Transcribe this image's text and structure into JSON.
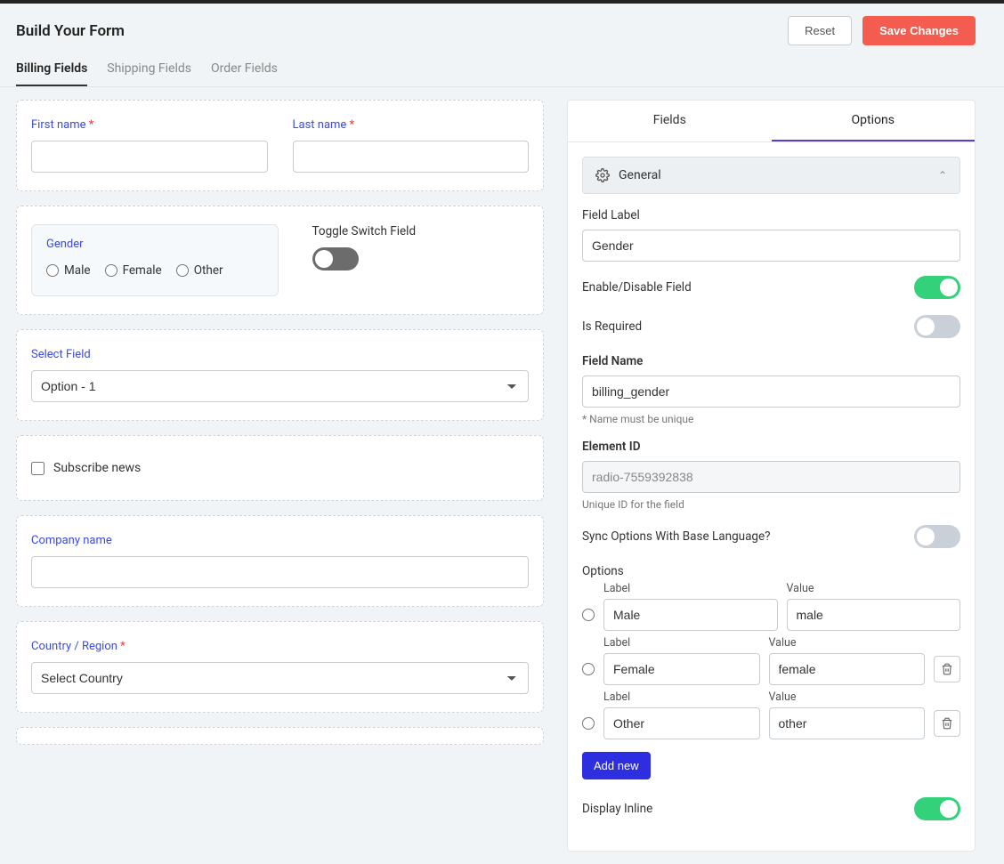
{
  "header": {
    "title": "Build Your Form",
    "reset": "Reset",
    "save": "Save Changes"
  },
  "tabs": [
    "Billing Fields",
    "Shipping Fields",
    "Order Fields"
  ],
  "form": {
    "first_name": {
      "label": "First name"
    },
    "last_name": {
      "label": "Last name"
    },
    "gender": {
      "label": "Gender",
      "options": [
        "Male",
        "Female",
        "Other"
      ]
    },
    "toggle_switch": {
      "label": "Toggle Switch Field"
    },
    "select_field": {
      "label": "Select Field",
      "selected": "Option - 1"
    },
    "subscribe": {
      "label": "Subscribe news"
    },
    "company": {
      "label": "Company name"
    },
    "country": {
      "label": "Country / Region",
      "placeholder": "Select Country"
    }
  },
  "panel": {
    "tabs": [
      "Fields",
      "Options"
    ],
    "general": "General",
    "field_label": {
      "label": "Field Label",
      "value": "Gender"
    },
    "enable": {
      "label": "Enable/Disable Field"
    },
    "required": {
      "label": "Is Required"
    },
    "field_name": {
      "label": "Field Name",
      "value": "billing_gender",
      "hint": "* Name must be unique"
    },
    "element_id": {
      "label": "Element ID",
      "value": "radio-7559392838",
      "hint": "Unique ID for the field"
    },
    "sync": {
      "label": "Sync Options With Base Language?"
    },
    "options": {
      "heading": "Options",
      "label_col": "Label",
      "value_col": "Value",
      "items": [
        {
          "label": "Male",
          "value": "male"
        },
        {
          "label": "Female",
          "value": "female"
        },
        {
          "label": "Other",
          "value": "other"
        }
      ],
      "add": "Add new"
    },
    "display_inline": {
      "label": "Display Inline"
    }
  }
}
